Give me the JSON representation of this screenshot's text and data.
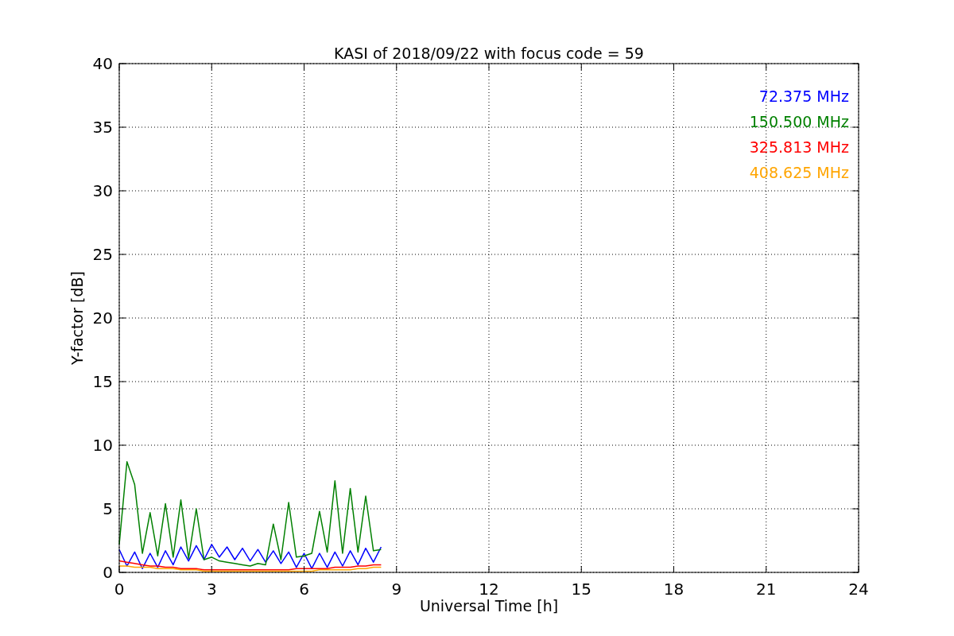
{
  "figure": {
    "chart_data": {
      "type": "line",
      "title": "KASI of 2018/09/22 with focus code = 59",
      "xlabel": "Universal Time [h]",
      "ylabel": "Y-factor [dB]",
      "x": [
        0,
        0.25,
        0.5,
        0.75,
        1,
        1.25,
        1.5,
        1.75,
        2,
        2.25,
        2.5,
        2.75,
        3,
        3.25,
        3.5,
        3.75,
        4,
        4.25,
        4.5,
        4.75,
        5,
        5.25,
        5.5,
        5.75,
        6,
        6.25,
        6.5,
        6.75,
        7,
        7.25,
        7.5,
        7.75,
        8,
        8.25,
        8.5
      ],
      "series": [
        {
          "name": "72.375 MHz",
          "color": "#0000ff",
          "values": [
            1.8,
            0.5,
            1.6,
            0.3,
            1.5,
            0.4,
            1.7,
            0.6,
            2.0,
            0.9,
            2.1,
            1.0,
            2.2,
            1.2,
            2.0,
            1.0,
            1.9,
            0.9,
            1.8,
            0.8,
            1.7,
            0.7,
            1.6,
            0.4,
            1.5,
            0.3,
            1.5,
            0.4,
            1.6,
            0.5,
            1.7,
            0.6,
            1.9,
            0.8,
            2.0
          ]
        },
        {
          "name": "150.500 MHz",
          "color": "#008000",
          "values": [
            2.2,
            8.7,
            6.9,
            1.5,
            4.7,
            1.3,
            5.4,
            1.2,
            5.7,
            1.1,
            5.0,
            1.0,
            1.2,
            0.9,
            0.8,
            0.7,
            0.6,
            0.5,
            0.7,
            0.6,
            3.8,
            1.0,
            5.5,
            1.2,
            1.3,
            1.5,
            4.8,
            1.6,
            7.2,
            1.5,
            6.6,
            1.6,
            6.0,
            1.7,
            1.8
          ]
        },
        {
          "name": "325.813 MHz",
          "color": "#ff0000",
          "values": [
            0.9,
            0.8,
            0.7,
            0.6,
            0.5,
            0.5,
            0.4,
            0.4,
            0.3,
            0.3,
            0.3,
            0.2,
            0.2,
            0.2,
            0.2,
            0.2,
            0.2,
            0.2,
            0.2,
            0.2,
            0.2,
            0.2,
            0.2,
            0.3,
            0.3,
            0.3,
            0.3,
            0.3,
            0.4,
            0.4,
            0.4,
            0.5,
            0.5,
            0.6,
            0.6
          ]
        },
        {
          "name": "408.625 MHz",
          "color": "#ffa500",
          "values": [
            0.5,
            0.5,
            0.4,
            0.4,
            0.4,
            0.3,
            0.3,
            0.3,
            0.2,
            0.2,
            0.2,
            0.1,
            0.1,
            0.1,
            0.1,
            0.1,
            0.1,
            0.1,
            0.1,
            0.1,
            0.1,
            0.1,
            0.1,
            0.1,
            0.1,
            0.1,
            0.2,
            0.2,
            0.2,
            0.2,
            0.2,
            0.3,
            0.3,
            0.4,
            0.4
          ]
        }
      ],
      "grid": true,
      "xlim": [
        0,
        24
      ],
      "ylim": [
        0,
        40
      ],
      "xticks": [
        0,
        3,
        6,
        9,
        12,
        15,
        18,
        21,
        24
      ],
      "yticks": [
        0,
        5,
        10,
        15,
        20,
        25,
        30,
        35,
        40
      ]
    }
  }
}
